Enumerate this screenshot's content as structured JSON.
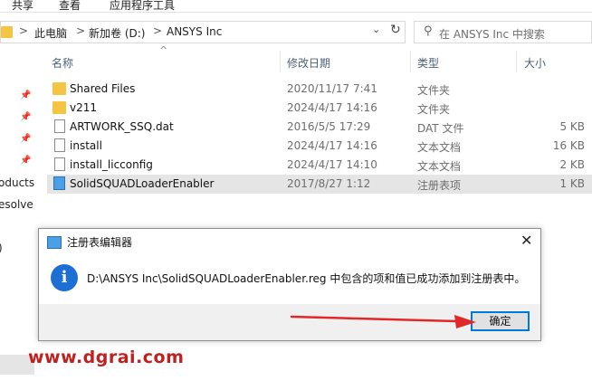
{
  "ribbon": {
    "tabs": [
      "共享",
      "查看",
      "应用程序工具"
    ]
  },
  "address": {
    "crumbs": [
      "此电脑",
      "新加卷 (D:)",
      "ANSYS Inc"
    ],
    "separator": ">",
    "dropdown_icon": "chevron-down-icon",
    "refresh_icon": "refresh-icon"
  },
  "search": {
    "placeholder": "在 ANSYS Inc 中搜索",
    "icon": "search-icon"
  },
  "nav": {
    "partial_items": [
      "oducts",
      "esolve",
      ")"
    ],
    "pin_icon": "pin-icon"
  },
  "columns": {
    "name": "名称",
    "modified": "修改日期",
    "type": "类型",
    "size": "大小"
  },
  "files": [
    {
      "name": "Shared Files",
      "modified": "2020/11/17 7:41",
      "type": "文件夹",
      "size": "",
      "icon": "folder-icon"
    },
    {
      "name": "v211",
      "modified": "2024/4/17 14:16",
      "type": "文件夹",
      "size": "",
      "icon": "folder-icon"
    },
    {
      "name": "ARTWORK_SSQ.dat",
      "modified": "2016/5/5 17:29",
      "type": "DAT 文件",
      "size": "5 KB",
      "icon": "file-icon"
    },
    {
      "name": "install",
      "modified": "2024/4/17 14:16",
      "type": "文本文档",
      "size": "16 KB",
      "icon": "text-file-icon"
    },
    {
      "name": "install_licconfig",
      "modified": "2024/4/17 14:10",
      "type": "文本文档",
      "size": "2 KB",
      "icon": "text-file-icon"
    },
    {
      "name": "SolidSQUADLoaderEnabler",
      "modified": "2017/8/27 1:12",
      "type": "注册表项",
      "size": "1 KB",
      "icon": "registry-file-icon",
      "selected": true
    }
  ],
  "dialog": {
    "title": "注册表编辑器",
    "message": "D:\\ANSYS Inc\\SolidSQUADLoaderEnabler.reg 中包含的项和值已成功添加到注册表中。",
    "ok_label": "确定",
    "info_glyph": "i",
    "close_glyph": "✕"
  },
  "watermark": "www.dgrai.com",
  "colors": {
    "accent": "#0078d7",
    "arrow": "#e0282a",
    "watermark": "#c0201e",
    "folder": "#f4c542"
  }
}
